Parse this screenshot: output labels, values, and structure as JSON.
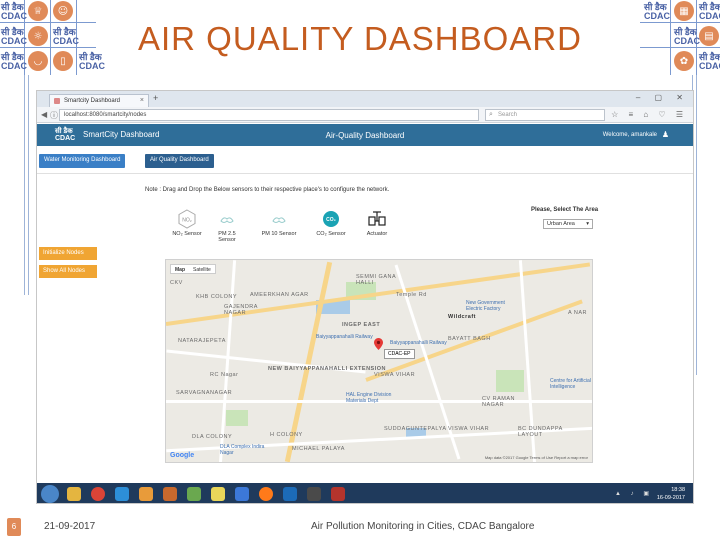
{
  "slide": {
    "title": "AIR QUALITY DASHBOARD",
    "footer_page": "6",
    "footer_date": "21-09-2017",
    "footer_caption": "Air Pollution Monitoring in Cities, CDAC Bangalore",
    "logo_text_top": "सी डैक",
    "logo_text_bottom": "CDAC"
  },
  "browser": {
    "tab_label": "Smartcity Dashboard",
    "tab_close": "×",
    "new_tab": "+",
    "url": "localhost:8080/smartcity/nodes",
    "search_placeholder": "Search",
    "window_controls": "– ▢ ✕",
    "nav_icons": "☆ ≡ ⌂ ♡ ☰"
  },
  "app": {
    "logo_top": "सी डैक",
    "logo_bottom": "CDAC",
    "name": "SmartCity Dashboard",
    "center_title": "Air-Quality Dashboard",
    "welcome": "Welcome, amankale",
    "buttons": {
      "water": "Water Monitoring Dashboard",
      "air": "Air Quality Dashboard"
    },
    "note": "Note : Drag and Drop the Below sensors to their respective place's to configure the network.",
    "sensors": [
      {
        "label": "NO₂ Sensor",
        "icon": "no2-icon",
        "glyph": "NO₂"
      },
      {
        "label": "PM 2.5 Sensor",
        "icon": "pm25-icon",
        "glyph": ""
      },
      {
        "label": "PM 10 Sensor",
        "icon": "pm10-icon",
        "glyph": ""
      },
      {
        "label": "CO₂ Sensor",
        "icon": "co2-icon",
        "glyph": "CO₂"
      },
      {
        "label": "Actuator",
        "icon": "actuator-icon",
        "glyph": ""
      }
    ],
    "area_label": "Please, Select The Area",
    "area_value": "Urban Area",
    "initialize_nodes": "Initialize Nodes",
    "show_all_nodes": "Show All Nodes"
  },
  "map": {
    "tabs": [
      "Map",
      "Satellite"
    ],
    "pin_label": "CDAC-EP",
    "google": "Google",
    "footer": "Map data ©2017 Google   Terms of Use   Report a map error",
    "labels": [
      {
        "text": "CKV"
      },
      {
        "text": "KHB COLONY"
      },
      {
        "text": "AMEERKHAN AGAR"
      },
      {
        "text": "GAJENDRA NAGAR"
      },
      {
        "text": "SEMMI GANA HALLI"
      },
      {
        "text": "INGEP EAST"
      },
      {
        "text": "NATARAJEPETA"
      },
      {
        "text": "NEW BAIYYAPPANAHALLI EXTENSION"
      },
      {
        "text": "VISWA VIHAR"
      },
      {
        "text": "BAYATT BAGH"
      },
      {
        "text": "A NAR"
      },
      {
        "text": "SARVAGNANAGAR"
      },
      {
        "text": "CV RAMAN NAGAR"
      },
      {
        "text": "SUDDAGUNTEPALYA"
      },
      {
        "text": "VISWA VIHAR"
      },
      {
        "text": "BC DUNDAPPA LAYOUT"
      },
      {
        "text": "H COLONY"
      },
      {
        "text": "MICHAEL PALAYA"
      },
      {
        "text": "DLA COLONY"
      },
      {
        "text": "RC Nagar"
      },
      {
        "text": "Wildcraft"
      },
      {
        "text": "Temple Rd"
      }
    ],
    "pois": [
      {
        "text": "New Government Electric Factory"
      },
      {
        "text": "Baiyyappanahalli Railway"
      },
      {
        "text": "Baiyyappanahalli Railway"
      },
      {
        "text": "HAL Engine Division Materials Dept"
      },
      {
        "text": "Centre for Artificial Intelligence"
      },
      {
        "text": "DLA Complex Indira Nagar"
      }
    ]
  },
  "taskbar": {
    "time": "18:38",
    "date": "16-09-2017",
    "tray": "▲ ♪ ▣"
  },
  "colors": {
    "title": "#c45c1f",
    "header": "#2f6e99",
    "button_blue": "#3a7fc6",
    "button_orange": "#f0a533",
    "taskbar": "#1f3a5c"
  }
}
